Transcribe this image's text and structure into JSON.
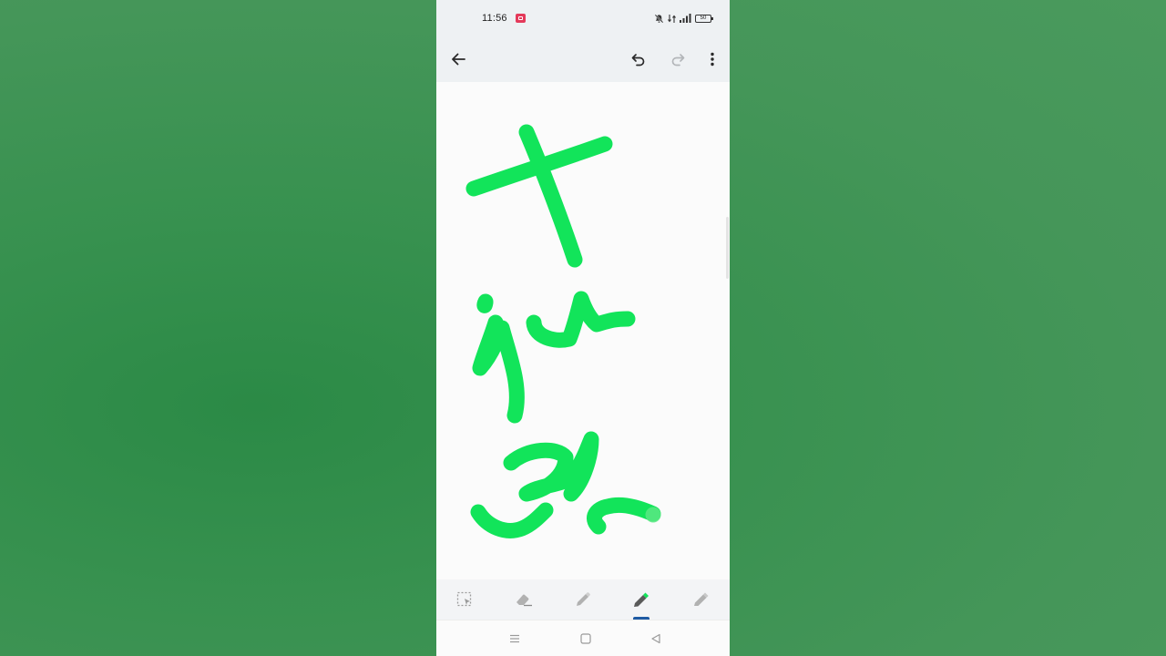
{
  "status_bar": {
    "time": "11:56",
    "battery_level": "50",
    "icons": [
      "screen-record-icon",
      "bell-off-icon",
      "mobile-data-icon",
      "signal-icon",
      "battery-icon"
    ]
  },
  "app_bar": {
    "icons": [
      "back-arrow-icon",
      "undo-icon",
      "redo-icon",
      "more-vert-icon"
    ],
    "redo_enabled": false
  },
  "canvas": {
    "ink_color": "#12e45a",
    "strokes": [
      "stroke-1",
      "stroke-2",
      "stroke-3"
    ]
  },
  "toolbar": {
    "tools": [
      "lasso-select-icon",
      "eraser-icon",
      "pen-icon",
      "marker-icon",
      "highlighter-icon"
    ],
    "selected_tool": "marker",
    "selected_color": "#12e45a"
  },
  "nav_bar": {
    "icons": [
      "recents-icon",
      "home-icon",
      "back-triangle-icon"
    ]
  },
  "colors": {
    "background": "#3d9355",
    "accent": "#1e5aa3",
    "ink": "#12e45a"
  }
}
